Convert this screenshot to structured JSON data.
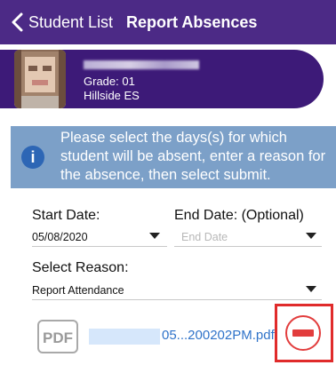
{
  "nav": {
    "back_label": "Student List",
    "title": "Report Absences"
  },
  "student": {
    "grade": "Grade: 01",
    "school": "Hillside ES"
  },
  "info": {
    "text": "Please select the days(s) for which student will be absent, enter a reason for the absence, then select submit."
  },
  "form": {
    "start_date_label": "Start Date:",
    "start_date_value": "05/08/2020",
    "end_date_label": "End Date: (Optional)",
    "end_date_placeholder": "End Date",
    "reason_label": "Select Reason:",
    "reason_value": "Report Attendance"
  },
  "attachment": {
    "type_label": "PDF",
    "file_name": "05...200202PM.pdf"
  },
  "colors": {
    "nav_bg": "#4c2a86",
    "student_bg": "#3d1a78",
    "info_bg": "#7ca0c8",
    "remove_red": "#e23d3d",
    "highlight_red": "#e02b2b"
  },
  "icons": {
    "back": "chevron-left-icon",
    "info": "info-icon",
    "pdf": "pdf-file-icon",
    "remove": "remove-minus-icon"
  }
}
